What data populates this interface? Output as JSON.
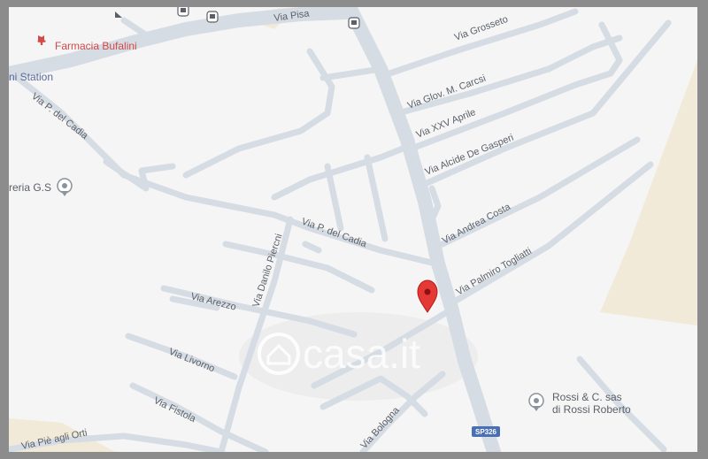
{
  "streets": {
    "via_pisa": "Via Pisa",
    "via_grosseto": "Via Grosseto",
    "via_glov_m_carcsi": "Via Glov. M. Carcsi",
    "via_xxv_aprile": "Via XXV Aprile",
    "via_alcide_de_gasperi": "Via Alcide De Gasperi",
    "via_andrea_costa": "Via Andrea Costa",
    "via_palmiro_togliatti": "Via Palmiro Togliatti",
    "via_p_del_cadia": "Via P. del Cadia",
    "via_danilo_piercni": "Via Danilo Piercni",
    "via_arezzo": "Via Arezzo",
    "via_livorno": "Via Livorno",
    "via_fistola": "Via Fistola",
    "via_pie_agli_orti": "Via Piè agli Orti",
    "via_bologna": "Via Bologna",
    "sp326": "SP326"
  },
  "pois": {
    "farmacia_bufalini": "Farmacia Bufalini",
    "station": "ni Station",
    "reria_gs": "reria G.S",
    "rossi_line1": "Rossi & C. sas",
    "rossi_line2": "di Rossi Roberto"
  },
  "watermark": "casa.it",
  "colors": {
    "background": "#f5f5f5",
    "road": "#d6dce3",
    "marker": "#e53935",
    "land": "#f2ead8",
    "pharmacy": "#d24a4a",
    "route_badge": "#4a6fb5"
  }
}
